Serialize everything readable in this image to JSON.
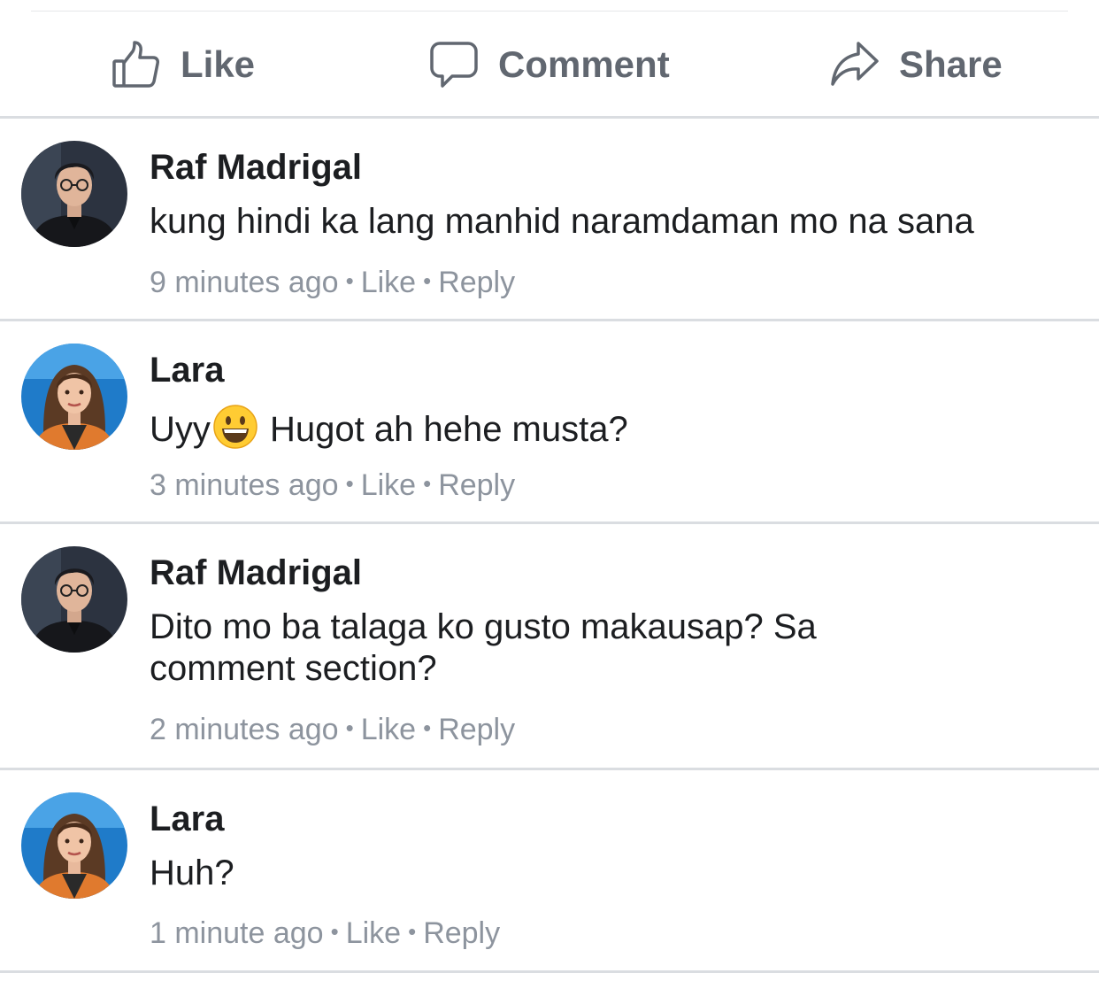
{
  "actions": {
    "like_label": "Like",
    "comment_label": "Comment",
    "share_label": "Share"
  },
  "comments": [
    {
      "author": "Raf Madrigal",
      "text": "kung hindi ka lang manhid naramdaman mo na sana",
      "time": "9 minutes ago",
      "like": "Like",
      "reply": "Reply"
    },
    {
      "author": "Lara",
      "text_before": "Uyy",
      "emoji": "grinning-face-emoji",
      "text_after": " Hugot ah hehe musta?",
      "time": "3 minutes ago",
      "like": "Like",
      "reply": "Reply"
    },
    {
      "author": "Raf Madrigal",
      "text": "Dito mo ba talaga ko gusto makausap? Sa comment section?",
      "time": "2 minutes ago",
      "like": "Like",
      "reply": "Reply"
    },
    {
      "author": "Lara",
      "text": "Huh?",
      "time": "1 minute ago",
      "like": "Like",
      "reply": "Reply"
    }
  ],
  "separator": "•",
  "colors": {
    "action_text": "#616770",
    "meta_text": "#8d949e",
    "body_text": "#1c1e21",
    "divider": "#dadde1"
  }
}
